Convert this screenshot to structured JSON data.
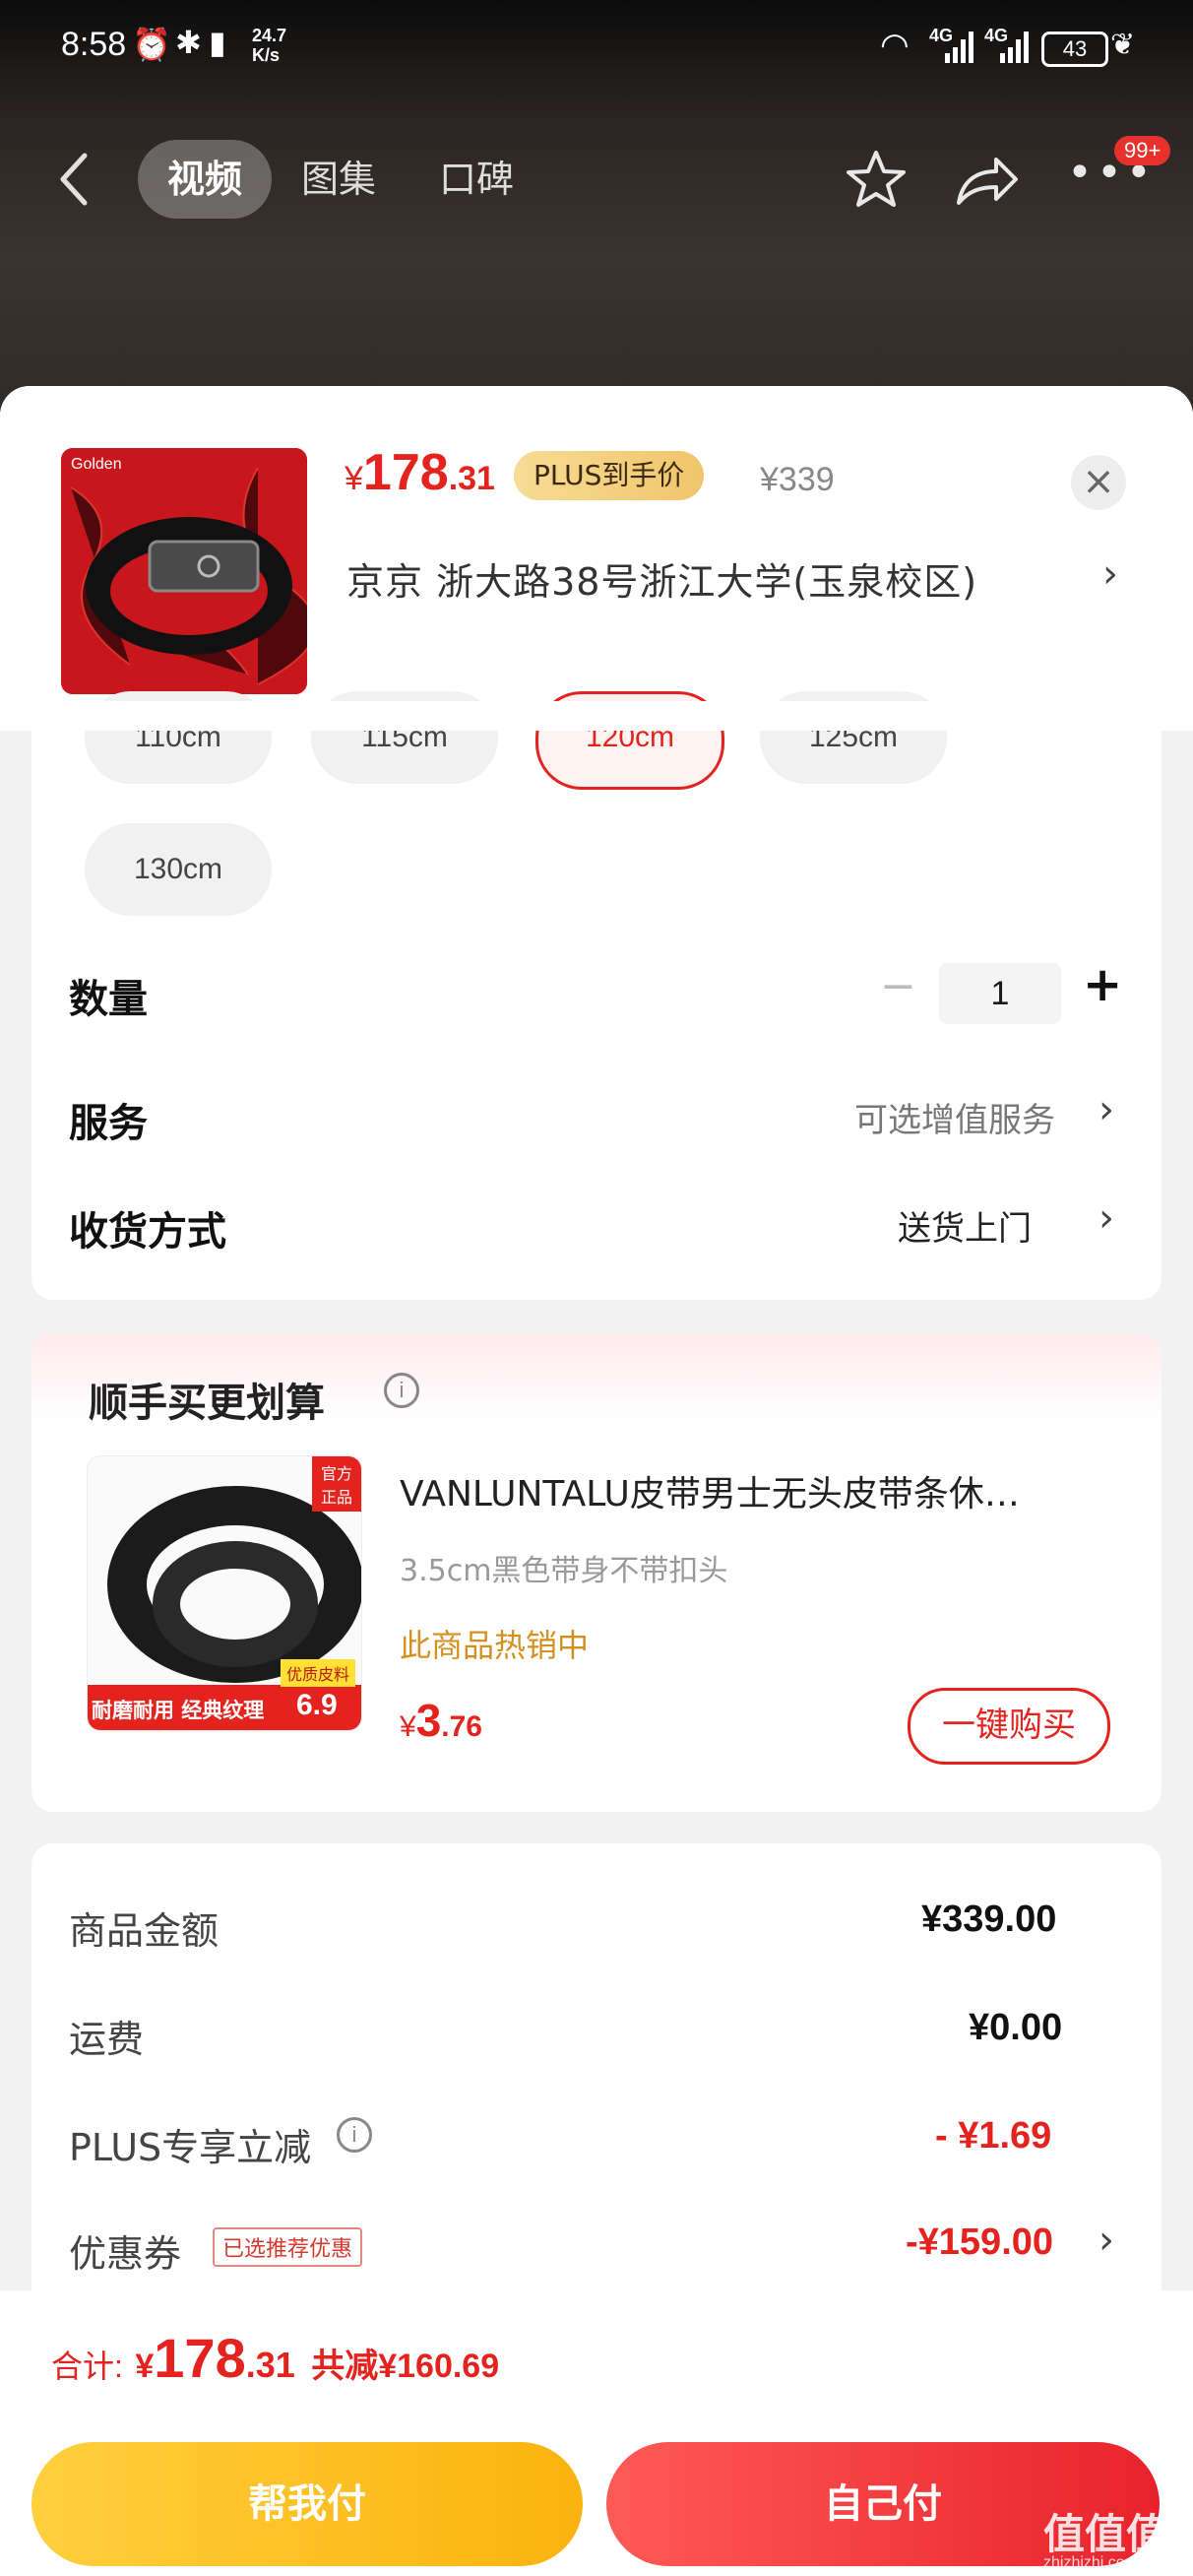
{
  "status_bar": {
    "time": "8:58",
    "speed_value": "24.7",
    "speed_unit": "K/s",
    "net1": "4G",
    "net2": "4G",
    "battery": "43"
  },
  "nav": {
    "tabs": [
      "视频",
      "图集",
      "口碑"
    ],
    "active_tab": 0,
    "badge": "99+"
  },
  "product": {
    "price_symbol": "¥",
    "price_int": "178",
    "price_dec": ".31",
    "plus_tag": "PLUS到手价",
    "original_price": "¥339",
    "close": "×",
    "address": "京京  浙大路38号浙江大学(玉泉校区)",
    "image_logo": "Golden"
  },
  "sizes": {
    "items": [
      "110cm",
      "115cm",
      "120cm",
      "125cm",
      "130cm"
    ],
    "selected": "120cm"
  },
  "quantity": {
    "label": "数量",
    "value": "1",
    "minus": "−",
    "plus": "+"
  },
  "service": {
    "label": "服务",
    "value": "可选增值服务"
  },
  "delivery": {
    "label": "收货方式",
    "value": "送货上门"
  },
  "upsell": {
    "title": "顺手买更划算",
    "item_title": "VANLUNTALU皮带男士无头皮带条休…",
    "item_spec": "3.5cm黑色带身不带扣头",
    "item_hot": "此商品热销中",
    "price_symbol": "¥",
    "price_int": "3",
    "price_dec": ".76",
    "buy_label": "一键购买",
    "img_tag_corner": "官方正品",
    "img_tag_quality": "优质皮料",
    "img_tag_features": "耐磨耐用 经典纹理",
    "img_tag_price": "6.9"
  },
  "summary": {
    "rows": [
      {
        "label": "商品金额",
        "value": "¥339.00"
      },
      {
        "label": "运费",
        "value": "¥0.00"
      },
      {
        "label": "PLUS专享立减",
        "value": "- ¥1.69"
      },
      {
        "label": "优惠券",
        "value": "-¥159.00",
        "tag": "已选推荐优惠"
      }
    ]
  },
  "footer": {
    "total_label": "合计:",
    "total_symbol": "¥",
    "total_int": "178",
    "total_dec": ".31",
    "discount": "共减¥160.69",
    "help_pay": "帮我付",
    "self_pay": "自己付"
  },
  "watermark": {
    "logo": "值值值",
    "site": "zhizhizhi.com"
  },
  "colors": {
    "accent_red": "#e4231f",
    "yellow_button": "#fbb30d",
    "plus_gold": "#f0c56b"
  }
}
